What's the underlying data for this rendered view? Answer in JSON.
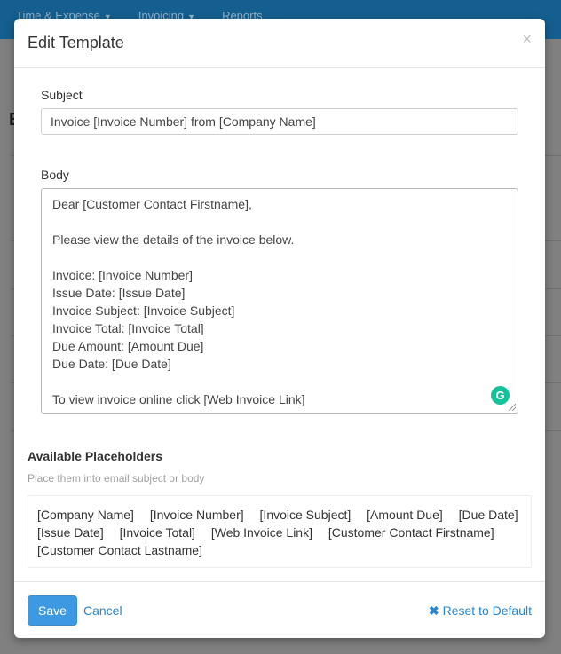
{
  "background": {
    "nav": [
      {
        "label": "Time & Expense"
      },
      {
        "label": "Invoicing"
      },
      {
        "label": "Reports"
      }
    ],
    "heading": "E"
  },
  "modal": {
    "title": "Edit Template",
    "close_icon": "×",
    "subject": {
      "label": "Subject",
      "value": "Invoice [Invoice Number] from [Company Name]"
    },
    "body": {
      "label": "Body",
      "lines": [
        "Dear [Customer Contact Firstname],",
        "",
        "Please view the details of the invoice below.",
        "",
        "Invoice: [Invoice Number]",
        "Issue Date: [Issue Date]",
        "Invoice Subject: [Invoice Subject]",
        "Invoice Total: [Invoice Total]",
        "Due Amount: [Amount Due]",
        "Due Date: [Due Date]",
        "",
        "To view invoice online click [Web Invoice Link]"
      ],
      "grammarly_icon": "G"
    },
    "placeholders": {
      "title": "Available Placeholders",
      "hint": "Place them into email subject or body",
      "items": [
        "[Company Name]",
        "[Invoice Number]",
        "[Invoice Subject]",
        "[Amount Due]",
        "[Due Date]",
        "[Issue Date]",
        "[Invoice Total]",
        "[Web Invoice Link]",
        "[Customer Contact Firstname]",
        "[Customer Contact Lastname]"
      ]
    },
    "footer": {
      "save_label": "Save",
      "cancel_label": "Cancel",
      "reset_icon": "✖",
      "reset_label": "Reset to Default"
    }
  },
  "colors": {
    "primary": "#3d9ae2",
    "link": "#2a85cb",
    "grammarly": "#15c39a"
  }
}
